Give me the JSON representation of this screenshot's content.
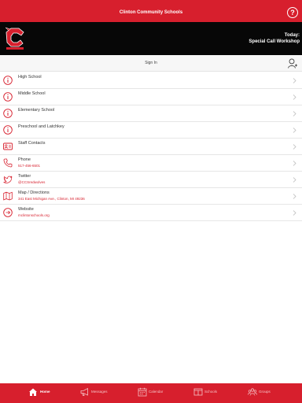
{
  "app": {
    "title": "Clinton Community Schools"
  },
  "banner": {
    "today_label": "Today:",
    "today_event": "Special Call Workshop"
  },
  "signin": {
    "label": "Sign In"
  },
  "list": [
    {
      "title": "High School",
      "subtitle": "",
      "icon": "info-icon"
    },
    {
      "title": "Middle School",
      "subtitle": "",
      "icon": "info-icon"
    },
    {
      "title": "Elementary School",
      "subtitle": "",
      "icon": "info-icon"
    },
    {
      "title": "Preschool and Latchkey",
      "subtitle": "",
      "icon": "info-icon"
    },
    {
      "title": "Staff Contacts",
      "subtitle": "",
      "icon": "contact-card-icon"
    },
    {
      "title": "Phone",
      "subtitle": "517-456-6501",
      "icon": "phone-icon"
    },
    {
      "title": "Twitter",
      "subtitle": "@CCSredwolves",
      "icon": "twitter-icon"
    },
    {
      "title": "Map / Directions",
      "subtitle": "341 East Michigan Ave., Clinton, MI 49236",
      "icon": "map-icon"
    },
    {
      "title": "Website",
      "subtitle": "mclintonschools.org",
      "icon": "website-icon"
    }
  ],
  "tabs": [
    {
      "label": "Home",
      "icon": "home-icon",
      "active": true
    },
    {
      "label": "Messages",
      "icon": "megaphone-icon",
      "active": false
    },
    {
      "label": "Calendar",
      "icon": "calendar-icon",
      "active": false
    },
    {
      "label": "Schools",
      "icon": "school-icon",
      "active": false
    },
    {
      "label": "Groups",
      "icon": "groups-icon",
      "active": false
    }
  ],
  "colors": {
    "brand": "#d71f2d",
    "banner": "#070707",
    "link": "#d71f2d"
  }
}
